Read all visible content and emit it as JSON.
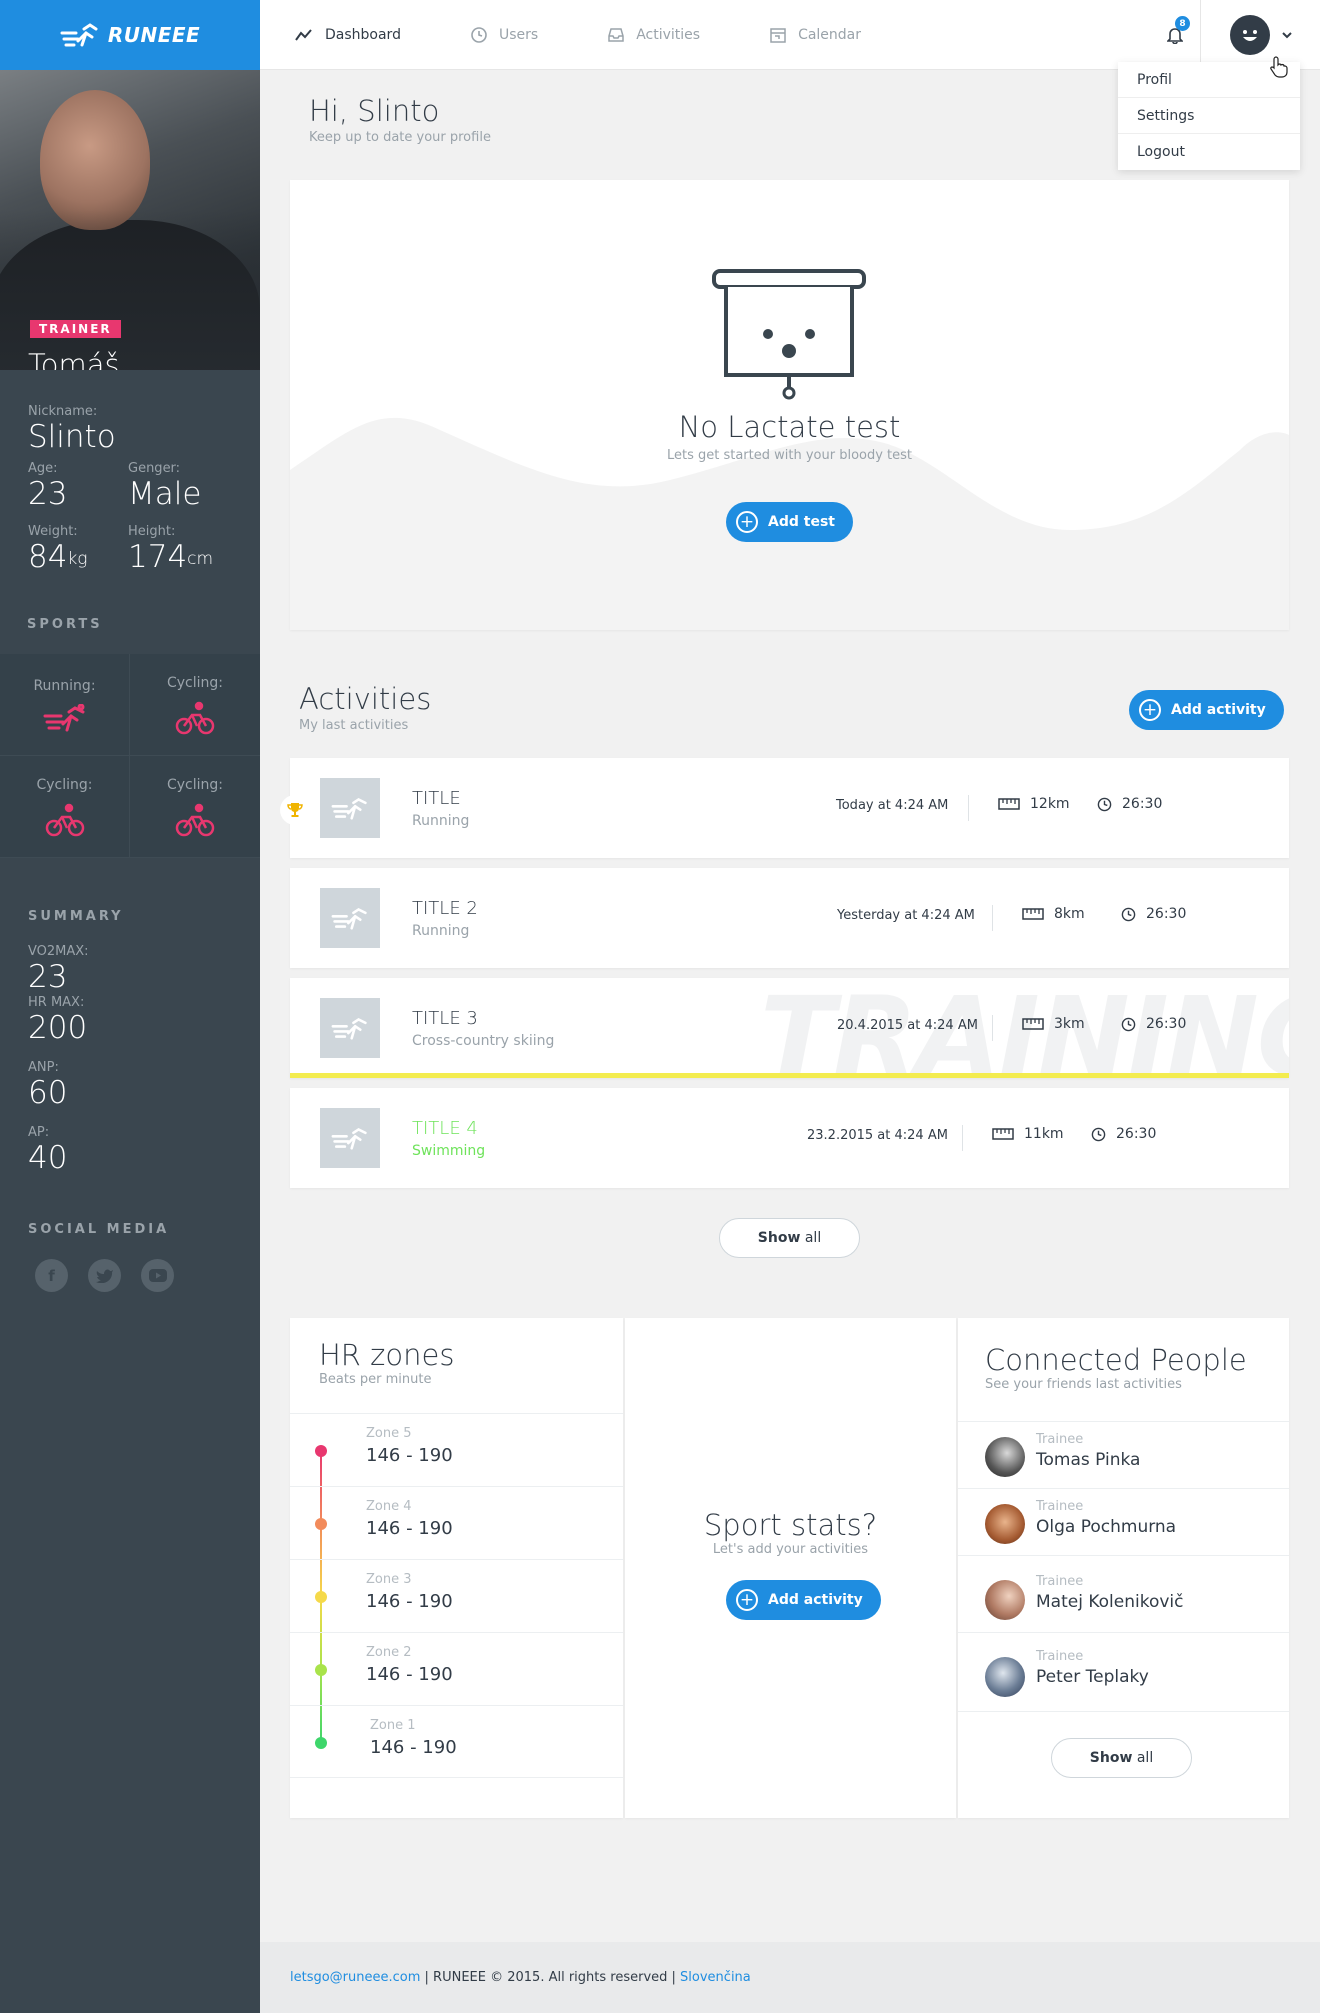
{
  "brand": {
    "name": "RUNEEE"
  },
  "nav": {
    "items": [
      {
        "label": "Dashboard",
        "icon": "chart-line-icon"
      },
      {
        "label": "Users",
        "icon": "clock-icon"
      },
      {
        "label": "Activities",
        "icon": "inbox-icon"
      },
      {
        "label": "Calendar",
        "icon": "calendar-icon"
      }
    ],
    "notifications_count": "8"
  },
  "user_menu": {
    "items": [
      "Profil",
      "Settings",
      "Logout"
    ]
  },
  "profile": {
    "badge": "TRAINER",
    "name": "Tomáš Stankovič",
    "nickname_label": "Nickname:",
    "nickname": "Slinto",
    "age_label": "Age:",
    "age": "23",
    "gender_label": "Genger:",
    "gender": "Male",
    "weight_label": "Weight:",
    "weight": "84",
    "weight_unit": "kg",
    "height_label": "Height:",
    "height": "174",
    "height_unit": "cm"
  },
  "sports": {
    "title": "SPORTS",
    "items": [
      {
        "label": "Running:",
        "icon": "running-icon"
      },
      {
        "label": "Cycling:",
        "icon": "cycling-icon"
      },
      {
        "label": "Cycling:",
        "icon": "cycling-icon"
      },
      {
        "label": "Cycling:",
        "icon": "cycling-icon"
      }
    ],
    "accent_color": "#e8376f"
  },
  "summary": {
    "title": "SUMMARY",
    "vo2max_label": "VO2MAX:",
    "vo2max": "23",
    "hrmax_label": "HR MAX:",
    "hrmax": "200",
    "anp_label": "ANP:",
    "anp": "60",
    "ap_label": "AP:",
    "ap": "40"
  },
  "social": {
    "title": "SOCIAL MEDIA",
    "items": [
      "facebook-icon",
      "twitter-icon",
      "youtube-icon"
    ]
  },
  "greeting": {
    "title": "Hi, Slinto",
    "subtitle": "Keep up to date your profile"
  },
  "lactate": {
    "title": "No Lactate test",
    "subtitle": "Lets get started with your bloody test",
    "button": "Add test"
  },
  "activities": {
    "title": "Activities",
    "subtitle": "My last activities",
    "add_button": "Add activity",
    "show_all_strong": "Show",
    "show_all_rest": "all",
    "watermark": "TRAINING",
    "rows": [
      {
        "title": "TITLE",
        "sport": "Running",
        "date": "Today at 4:24 AM",
        "distance": "12km",
        "time": "26:30"
      },
      {
        "title": "TITLE 2",
        "sport": "Running",
        "date": "Yesterday at 4:24 AM",
        "distance": "8km",
        "time": "26:30"
      },
      {
        "title": "TITLE 3",
        "sport": "Cross-country skiing",
        "date": "20.4.2015 at 4:24 AM",
        "distance": "3km",
        "time": "26:30"
      },
      {
        "title": "TITLE 4",
        "sport": "Swimming",
        "date": "23.2.2015 at 4:24 AM",
        "distance": "11km",
        "time": "26:30"
      }
    ]
  },
  "hr_zones": {
    "title": "HR zones",
    "subtitle": "Beats per minute",
    "zones": [
      {
        "label": "Zone 5",
        "range": "146 - 190",
        "color": "#e8376f"
      },
      {
        "label": "Zone 4",
        "range": "146 - 190",
        "color": "#f28b5b"
      },
      {
        "label": "Zone 3",
        "range": "146 - 190",
        "color": "#f5d94a"
      },
      {
        "label": "Zone 2",
        "range": "146 - 190",
        "color": "#a9e34b"
      },
      {
        "label": "Zone 1",
        "range": "146 - 190",
        "color": "#3ed66b"
      }
    ]
  },
  "sport_stats": {
    "title": "Sport stats?",
    "subtitle": "Let's add your activities",
    "button": "Add activity"
  },
  "people": {
    "title": "Connected People",
    "subtitle": "See your friends last activities",
    "show_all_strong": "Show",
    "show_all_rest": "all",
    "items": [
      {
        "role": "Trainee",
        "name": "Tomas Pinka"
      },
      {
        "role": "Trainee",
        "name": "Olga Pochmurna"
      },
      {
        "role": "Trainee",
        "name": "Matej Kolenikovič"
      },
      {
        "role": "Trainee",
        "name": "Peter Teplaky"
      }
    ]
  },
  "footer": {
    "email": "letsgo@runeee.com",
    "copyright": " | RUNEEE © 2015. All rights reserved | ",
    "language": "Slovenčina"
  },
  "colors": {
    "primary": "#1f8de0",
    "sidebar": "#3a464f",
    "accent": "#e8376f",
    "highlight": "#f3ec4f"
  }
}
